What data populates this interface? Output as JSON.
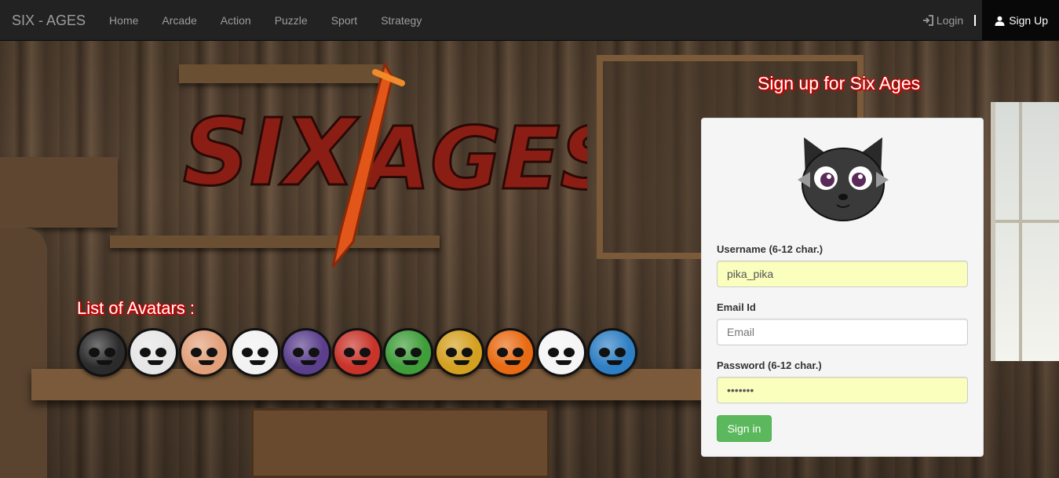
{
  "navbar": {
    "brand": "SIX - AGES",
    "items": [
      "Home",
      "Arcade",
      "Action",
      "Puzzle",
      "Sport",
      "Strategy"
    ],
    "login_label": "Login",
    "signup_label": "Sign Up"
  },
  "logo": {
    "text_left": "SIX",
    "text_right": "AGES"
  },
  "avatars": {
    "title": "List of Avatars :",
    "items": [
      {
        "name": "reaper",
        "color": "#2b2b2b"
      },
      {
        "name": "mask",
        "color": "#e6e6e6"
      },
      {
        "name": "bearded",
        "color": "#e2a07a"
      },
      {
        "name": "harley",
        "color": "#f2f2f2"
      },
      {
        "name": "hawkeye",
        "color": "#5b3f8c"
      },
      {
        "name": "hellboy",
        "color": "#c8332a"
      },
      {
        "name": "hulk",
        "color": "#3f9d3a"
      },
      {
        "name": "ironman",
        "color": "#d4a020"
      },
      {
        "name": "pumpkin",
        "color": "#e86a12"
      },
      {
        "name": "skeleton",
        "color": "#f5f5f5"
      },
      {
        "name": "alien",
        "color": "#2f7fc4"
      }
    ]
  },
  "signup": {
    "title": "Sign up for Six Ages",
    "username_label": "Username (6-12 char.)",
    "username_value": "pika_pika",
    "email_label": "Email Id",
    "email_placeholder": "Email",
    "password_label": "Password (6-12 char.)",
    "password_value": "•••••••",
    "submit_label": "Sign in"
  },
  "colors": {
    "navbar_bg": "#222222",
    "submit_bg": "#5cb85c",
    "autofill_bg": "#faffbd",
    "title_shadow": "#cc0000"
  }
}
